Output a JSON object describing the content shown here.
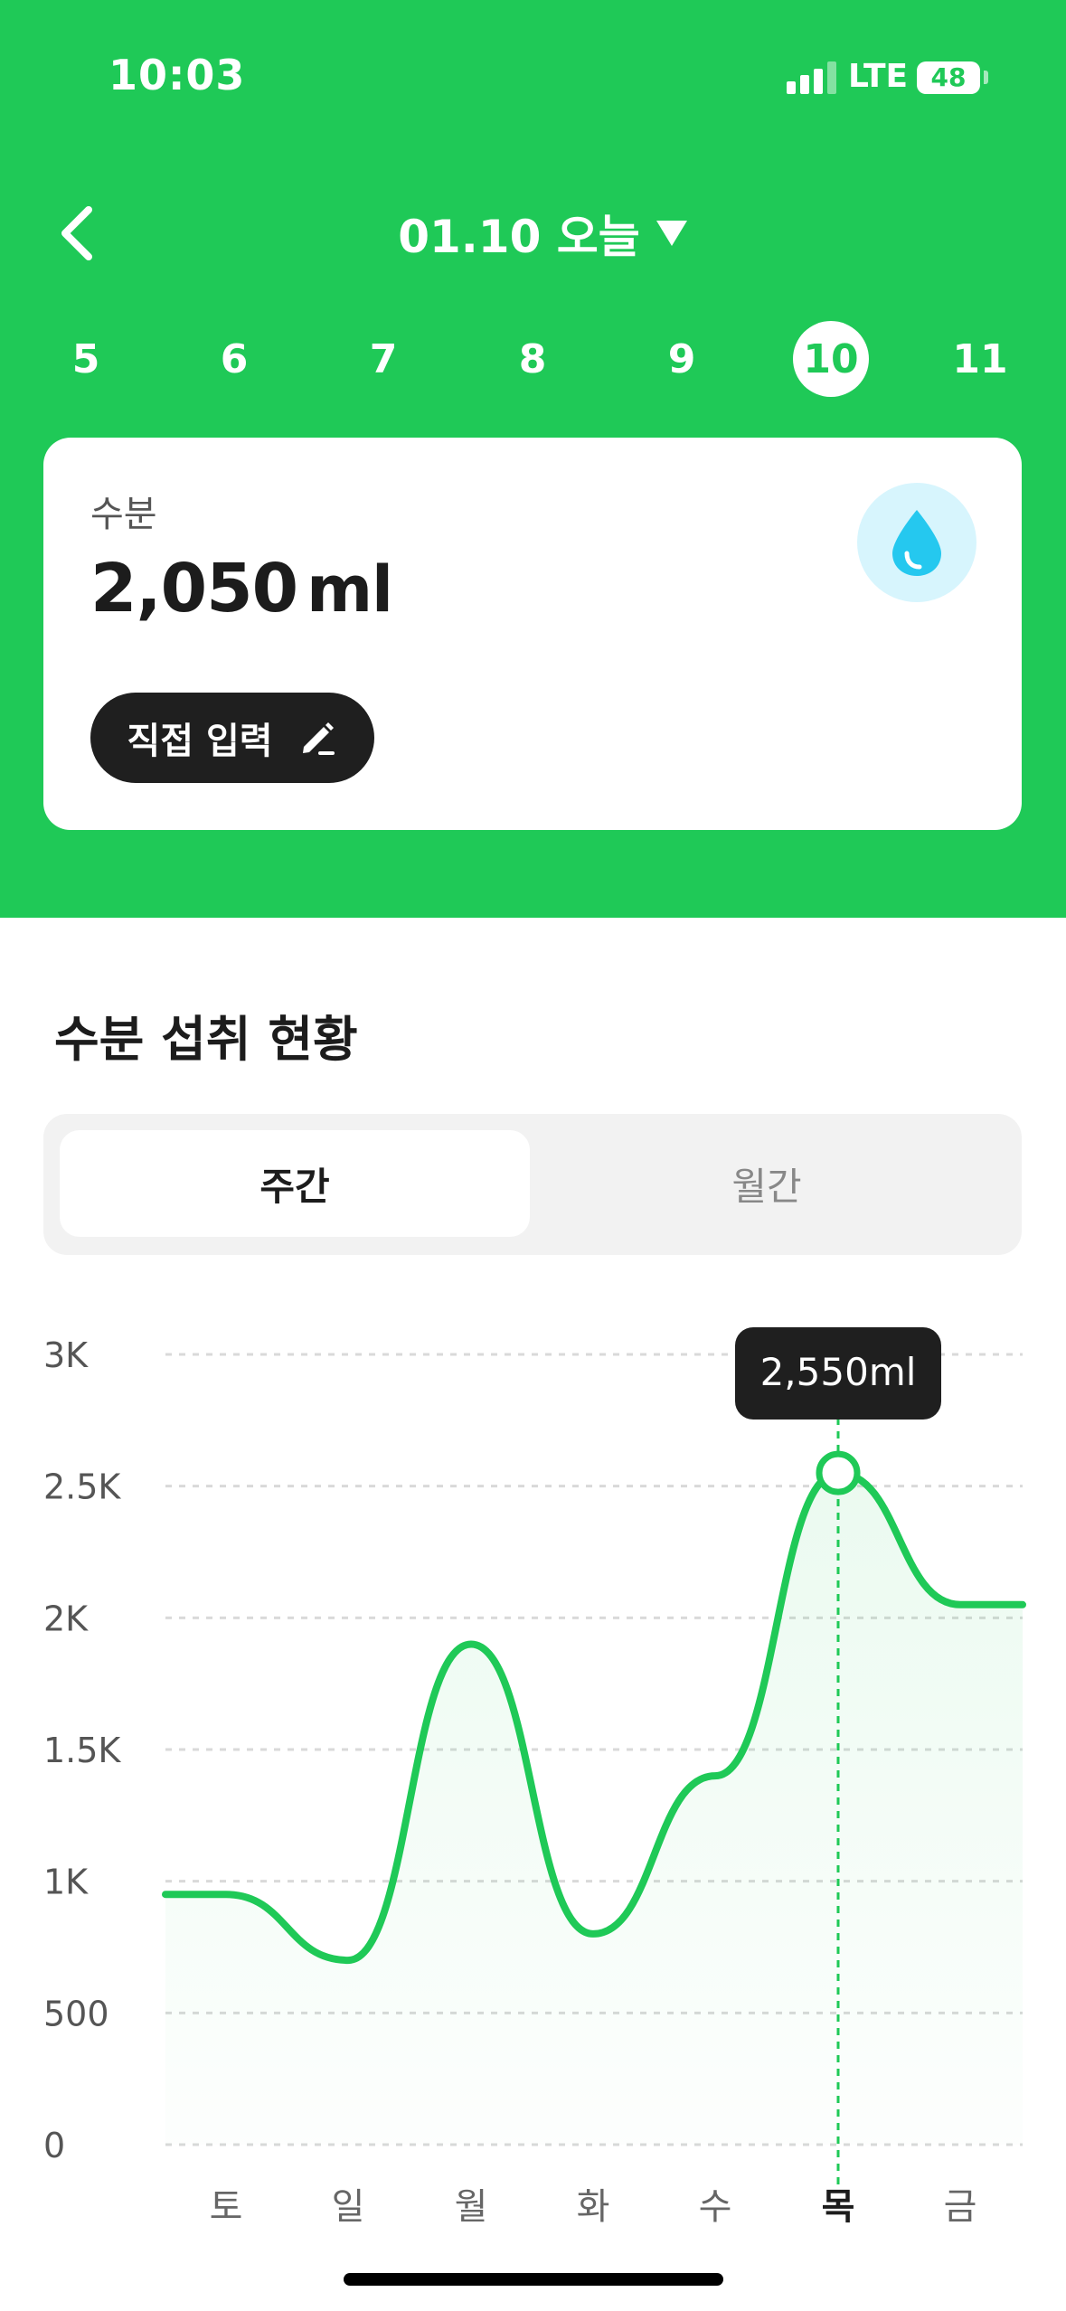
{
  "status_bar": {
    "time": "10:03",
    "network": "LTE",
    "battery": "48"
  },
  "header": {
    "back_icon": "chevron-left-icon",
    "date_title": "01.10 오늘",
    "dropdown_icon": "triangle-down-icon"
  },
  "days": [
    {
      "label": "5",
      "selected": false
    },
    {
      "label": "6",
      "selected": false
    },
    {
      "label": "7",
      "selected": false
    },
    {
      "label": "8",
      "selected": false
    },
    {
      "label": "9",
      "selected": false
    },
    {
      "label": "10",
      "selected": true
    },
    {
      "label": "11",
      "selected": false
    }
  ],
  "card": {
    "label": "수분",
    "value": "2,050",
    "unit": "ml",
    "icon": "water-drop-icon",
    "button_label": "직접 입력",
    "button_icon": "pencil-icon"
  },
  "section": {
    "title": "수분 섭취 현황",
    "tabs": [
      {
        "label": "주간",
        "active": true
      },
      {
        "label": "월간",
        "active": false
      }
    ]
  },
  "colors": {
    "brand_green": "#1fc957",
    "water_blue": "#25c8ef",
    "tooltip_bg": "#1f1f1f"
  },
  "chart_data": {
    "type": "area",
    "categories": [
      "토",
      "일",
      "월",
      "화",
      "수",
      "목",
      "금"
    ],
    "values": [
      950,
      700,
      1900,
      800,
      1400,
      2550,
      2050
    ],
    "y_ticks": [
      "0",
      "500",
      "1K",
      "1.5K",
      "2K",
      "2.5K",
      "3K"
    ],
    "ylim": [
      0,
      3000
    ],
    "highlight_index": 5,
    "tooltip": "2,550ml",
    "grid": true
  }
}
